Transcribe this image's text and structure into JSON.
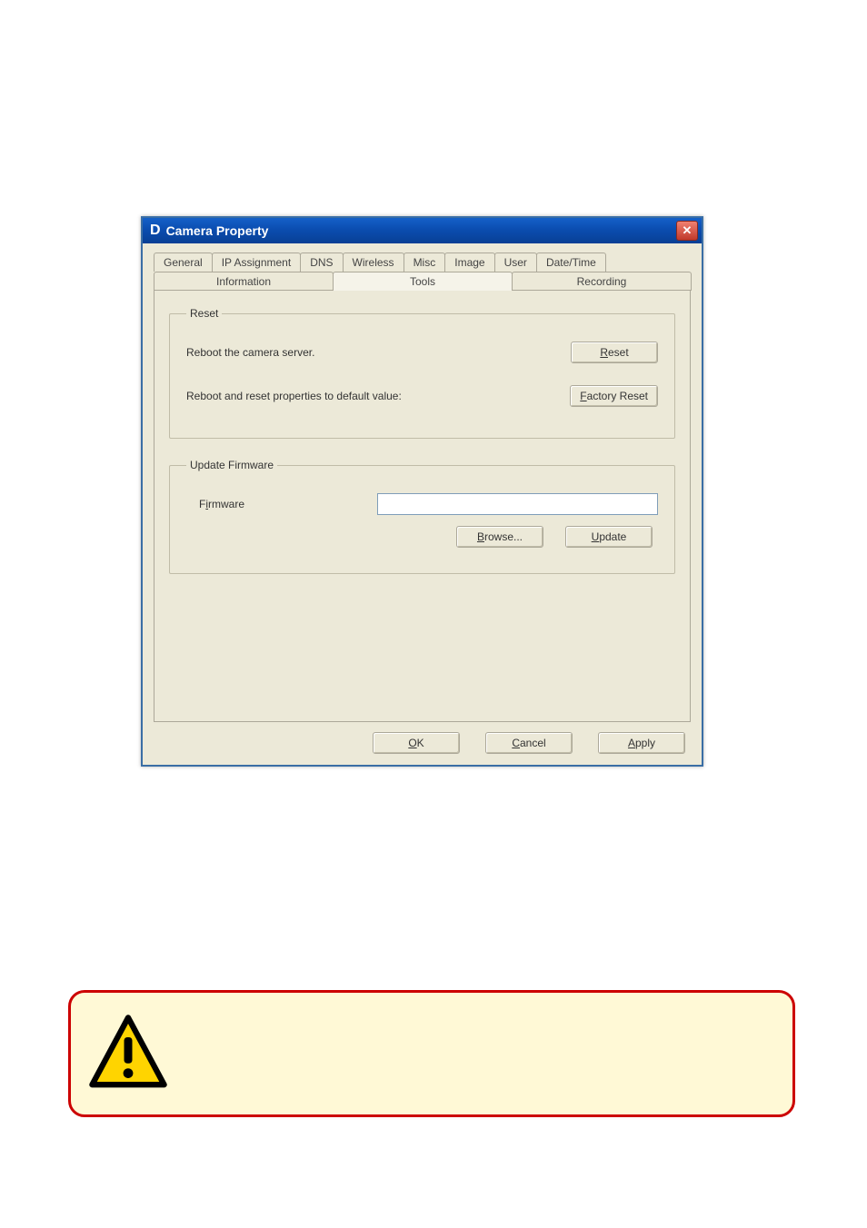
{
  "window": {
    "title_prefix": "D",
    "title": "Camera Property",
    "close_label": "✕"
  },
  "tabs_row1": {
    "general": "General",
    "ip_assignment": "IP Assignment",
    "dns": "DNS",
    "wireless": "Wireless",
    "misc": "Misc",
    "image": "Image",
    "user": "User",
    "datetime": "Date/Time"
  },
  "tabs_row2": {
    "information": "Information",
    "tools": "Tools",
    "recording": "Recording"
  },
  "reset_group": {
    "legend": "Reset",
    "reboot_label": "Reboot the camera server.",
    "reboot_btn_pre": "",
    "reboot_btn_accel": "R",
    "reboot_btn_post": "eset",
    "factory_label": "Reboot and reset properties to default value:",
    "factory_btn_pre": "",
    "factory_btn_accel": "F",
    "factory_btn_post": "actory Reset"
  },
  "firmware_group": {
    "legend": "Update Firmware",
    "label_pre": "F",
    "label_accel": "i",
    "label_post": "rmware",
    "input_value": "",
    "browse_pre": "",
    "browse_accel": "B",
    "browse_post": "rowse...",
    "update_pre": "",
    "update_accel": "U",
    "update_post": "pdate"
  },
  "dialog_buttons": {
    "ok_pre": "",
    "ok_accel": "O",
    "ok_post": "K",
    "cancel_pre": "",
    "cancel_accel": "C",
    "cancel_post": "ancel",
    "apply_pre": "",
    "apply_accel": "A",
    "apply_post": "pply"
  }
}
